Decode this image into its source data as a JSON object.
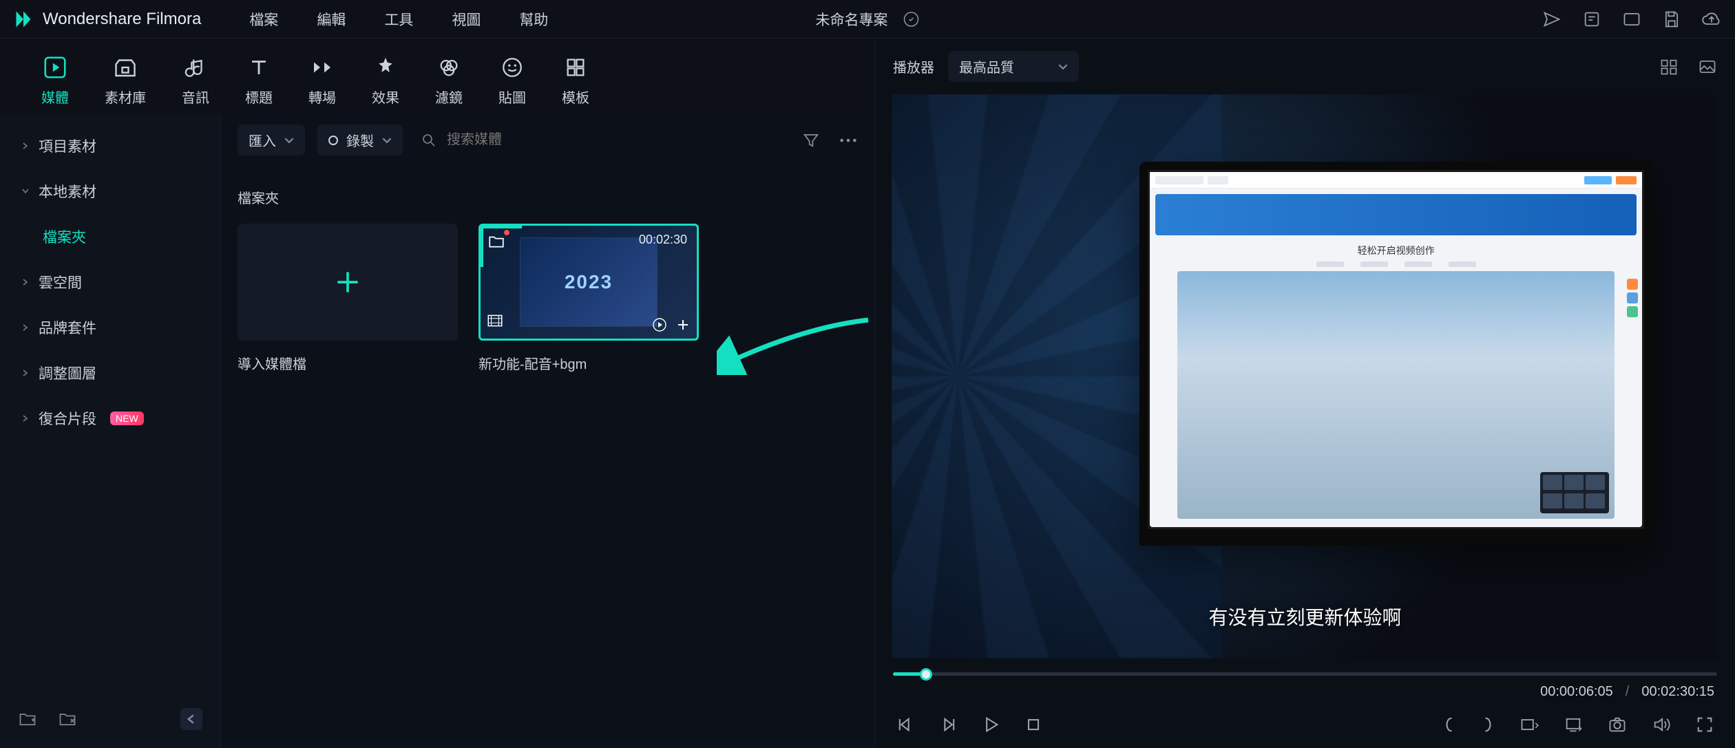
{
  "app": {
    "name": "Wondershare Filmora",
    "project_name": "未命名專案"
  },
  "menu": {
    "file": "檔案",
    "edit": "編輯",
    "tools": "工具",
    "view": "視圖",
    "help": "幫助"
  },
  "tabs": {
    "media": "媒體",
    "stock": "素材庫",
    "audio": "音訊",
    "titles": "標題",
    "transitions": "轉場",
    "effects": "效果",
    "filters": "濾鏡",
    "stickers": "貼圖",
    "templates": "模板"
  },
  "sidebar": {
    "project": "項目素材",
    "local": "本地素材",
    "folder": "檔案夾",
    "cloud": "雲空間",
    "brand": "品牌套件",
    "layers": "調整圖層",
    "compound": "復合片段",
    "new_badge": "NEW"
  },
  "browser": {
    "import": "匯入",
    "record": "錄製",
    "search_placeholder": "搜索媒體",
    "folder_label": "檔案夾",
    "import_tile_caption": "導入媒體檔",
    "clip": {
      "name": "新功能-配音+bgm",
      "duration": "00:02:30",
      "thumb_text": "2023"
    }
  },
  "player": {
    "label": "播放器",
    "quality": "最高品質",
    "subtitle": "有没有立刻更新体验啊",
    "laptop_text": "轻松开启视频创作",
    "current_time": "00:00:06:05",
    "total_time": "00:02:30:15",
    "separator": "/"
  }
}
